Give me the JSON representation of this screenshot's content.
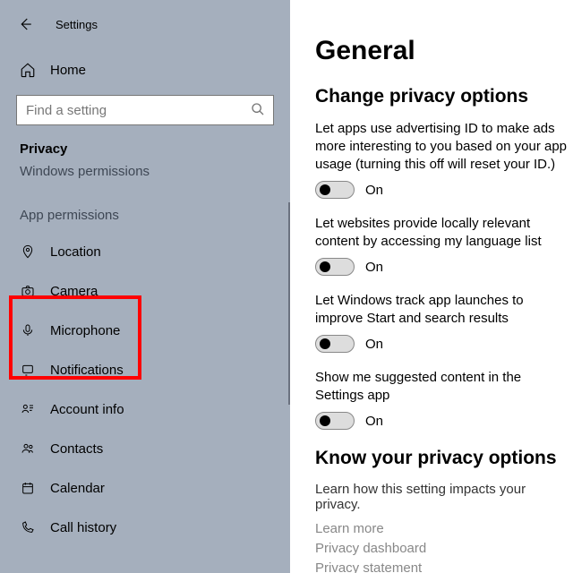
{
  "window": {
    "title": "Settings"
  },
  "sidebar": {
    "home": "Home",
    "search_placeholder": "Find a setting",
    "section": "Privacy",
    "subsection": "Windows permissions",
    "group_label": "App permissions",
    "items": [
      {
        "icon": "location",
        "label": "Location"
      },
      {
        "icon": "camera",
        "label": "Camera"
      },
      {
        "icon": "microphone",
        "label": "Microphone"
      },
      {
        "icon": "notifications",
        "label": "Notifications"
      },
      {
        "icon": "account-info",
        "label": "Account info"
      },
      {
        "icon": "contacts",
        "label": "Contacts"
      },
      {
        "icon": "calendar",
        "label": "Calendar"
      },
      {
        "icon": "call-history",
        "label": "Call history"
      }
    ]
  },
  "main": {
    "heading": "General",
    "subheading": "Change privacy options",
    "options": [
      {
        "desc": "Let apps use advertising ID to make ads more interesting to you based on your app usage (turning this off will reset your ID.)",
        "state": "On"
      },
      {
        "desc": "Let websites provide locally relevant content by accessing my language list",
        "state": "On"
      },
      {
        "desc": "Let Windows track app launches to improve Start and search results",
        "state": "On"
      },
      {
        "desc": "Show me suggested content in the Settings app",
        "state": "On"
      }
    ],
    "know": {
      "heading": "Know your privacy options",
      "desc": "Learn how this setting impacts your privacy.",
      "links": [
        "Learn more",
        "Privacy dashboard",
        "Privacy statement"
      ]
    }
  }
}
